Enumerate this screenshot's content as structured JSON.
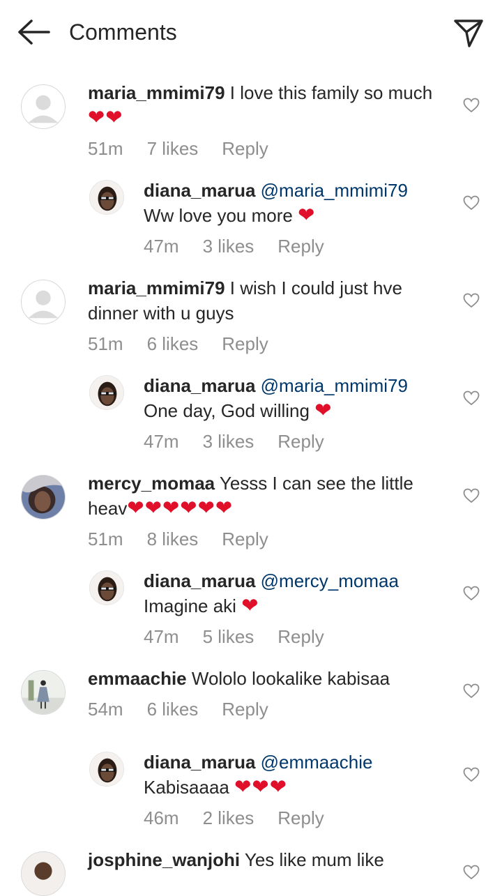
{
  "header": {
    "title": "Comments"
  },
  "comments": [
    {
      "username": "maria_mmimi79",
      "text": " I love this family so much ",
      "hearts": "❤❤",
      "time": "51m",
      "likes": "7 likes",
      "reply": "Reply"
    },
    {
      "username": "diana_marua",
      "mention": "@maria_mmimi79",
      "text": "Ww love you more ",
      "hearts": "❤",
      "time": "47m",
      "likes": "3 likes",
      "reply": "Reply"
    },
    {
      "username": "maria_mmimi79",
      "text": " I wish I could just hve dinner with u guys",
      "time": "51m",
      "likes": "6 likes",
      "reply": "Reply"
    },
    {
      "username": "diana_marua",
      "mention": "@maria_mmimi79",
      "text": "One day,  God willing ",
      "hearts": "❤",
      "time": "47m",
      "likes": "3 likes",
      "reply": "Reply"
    },
    {
      "username": "mercy_momaa",
      "text": " Yesss I can see the little heav",
      "hearts": "❤❤❤❤❤❤",
      "time": "51m",
      "likes": "8 likes",
      "reply": "Reply"
    },
    {
      "username": "diana_marua",
      "mention": "@mercy_momaa",
      "text": "Imagine aki ",
      "hearts": "❤",
      "time": "47m",
      "likes": "5 likes",
      "reply": "Reply"
    },
    {
      "username": "emmaachie",
      "text": " Wololo lookalike kabisaa",
      "time": "54m",
      "likes": "6 likes",
      "reply": "Reply"
    },
    {
      "username": "diana_marua",
      "mention": "@emmaachie",
      "text": "Kabisaaaa ",
      "hearts": "❤❤❤",
      "time": "46m",
      "likes": "2 likes",
      "reply": "Reply"
    },
    {
      "username": "josphine_wanjohi",
      "text": " Yes like mum like"
    }
  ]
}
